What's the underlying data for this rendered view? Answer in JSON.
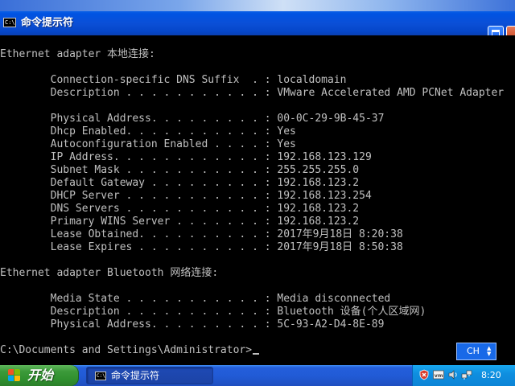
{
  "window": {
    "title": "命令提示符",
    "title_icon_text": "C:\\"
  },
  "console": {
    "lines": [
      "",
      "Ethernet adapter 本地连接:",
      "",
      "        Connection-specific DNS Suffix  . : localdomain",
      "        Description . . . . . . . . . . . : VMware Accelerated AMD PCNet Adapter",
      "",
      "        Physical Address. . . . . . . . . : 00-0C-29-9B-45-37",
      "        Dhcp Enabled. . . . . . . . . . . : Yes",
      "        Autoconfiguration Enabled . . . . : Yes",
      "        IP Address. . . . . . . . . . . . : 192.168.123.129",
      "        Subnet Mask . . . . . . . . . . . : 255.255.255.0",
      "        Default Gateway . . . . . . . . . : 192.168.123.2",
      "        DHCP Server . . . . . . . . . . . : 192.168.123.254",
      "        DNS Servers . . . . . . . . . . . : 192.168.123.2",
      "        Primary WINS Server . . . . . . . : 192.168.123.2",
      "        Lease Obtained. . . . . . . . . . : 2017年9月18日 8:20:38",
      "        Lease Expires . . . . . . . . . . : 2017年9月18日 8:50:38",
      "",
      "Ethernet adapter Bluetooth 网络连接:",
      "",
      "        Media State . . . . . . . . . . . : Media disconnected",
      "        Description . . . . . . . . . . . : Bluetooth 设备(个人区域网)",
      "        Physical Address. . . . . . . . . : 5C-93-A2-D4-8E-89",
      "",
      "C:\\Documents and Settings\\Administrator>"
    ]
  },
  "ime": {
    "label": "CH"
  },
  "taskbar": {
    "start_label": "开始",
    "task_item_label": "命令提示符",
    "task_icon_text": "C:\\",
    "clock": "8:20"
  },
  "colors": {
    "console_text": "#c0c0c0",
    "console_background": "#000000",
    "titlebar_blue": "#0054e3",
    "taskbar_blue": "#245edb",
    "start_green": "#3c9a3a",
    "tray_blue": "#0f8fe0"
  }
}
